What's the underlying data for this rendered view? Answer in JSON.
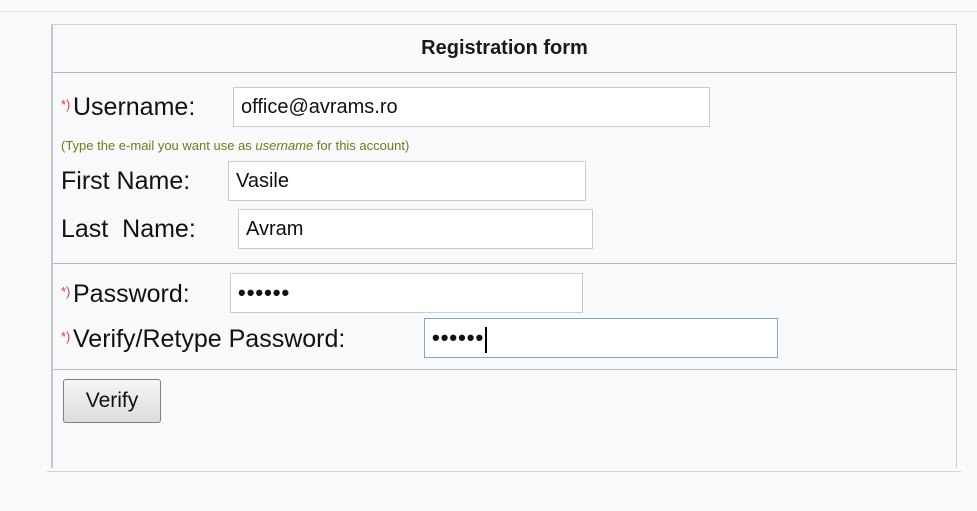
{
  "form": {
    "title": "Registration form",
    "required_marker": "*)",
    "username": {
      "label": "Username:",
      "value": "office@avrams.ro",
      "hint_before": "(Type the e-mail you want use as ",
      "hint_emphasis": "username",
      "hint_after": " for this account)"
    },
    "first_name": {
      "label": "First Name:",
      "value": "Vasile"
    },
    "last_name": {
      "label": "Last  Name:",
      "value": "Avram"
    },
    "password": {
      "label": "Password:",
      "masked_value": "••••••"
    },
    "verify_password": {
      "label": "Verify/Retype Password:",
      "masked_value": "••••••"
    },
    "verify_button_label": "Verify"
  },
  "colors": {
    "required_marker": "#e03a3a",
    "hint_text": "#6b7d1a",
    "focus_border": "#7fa7d6"
  }
}
